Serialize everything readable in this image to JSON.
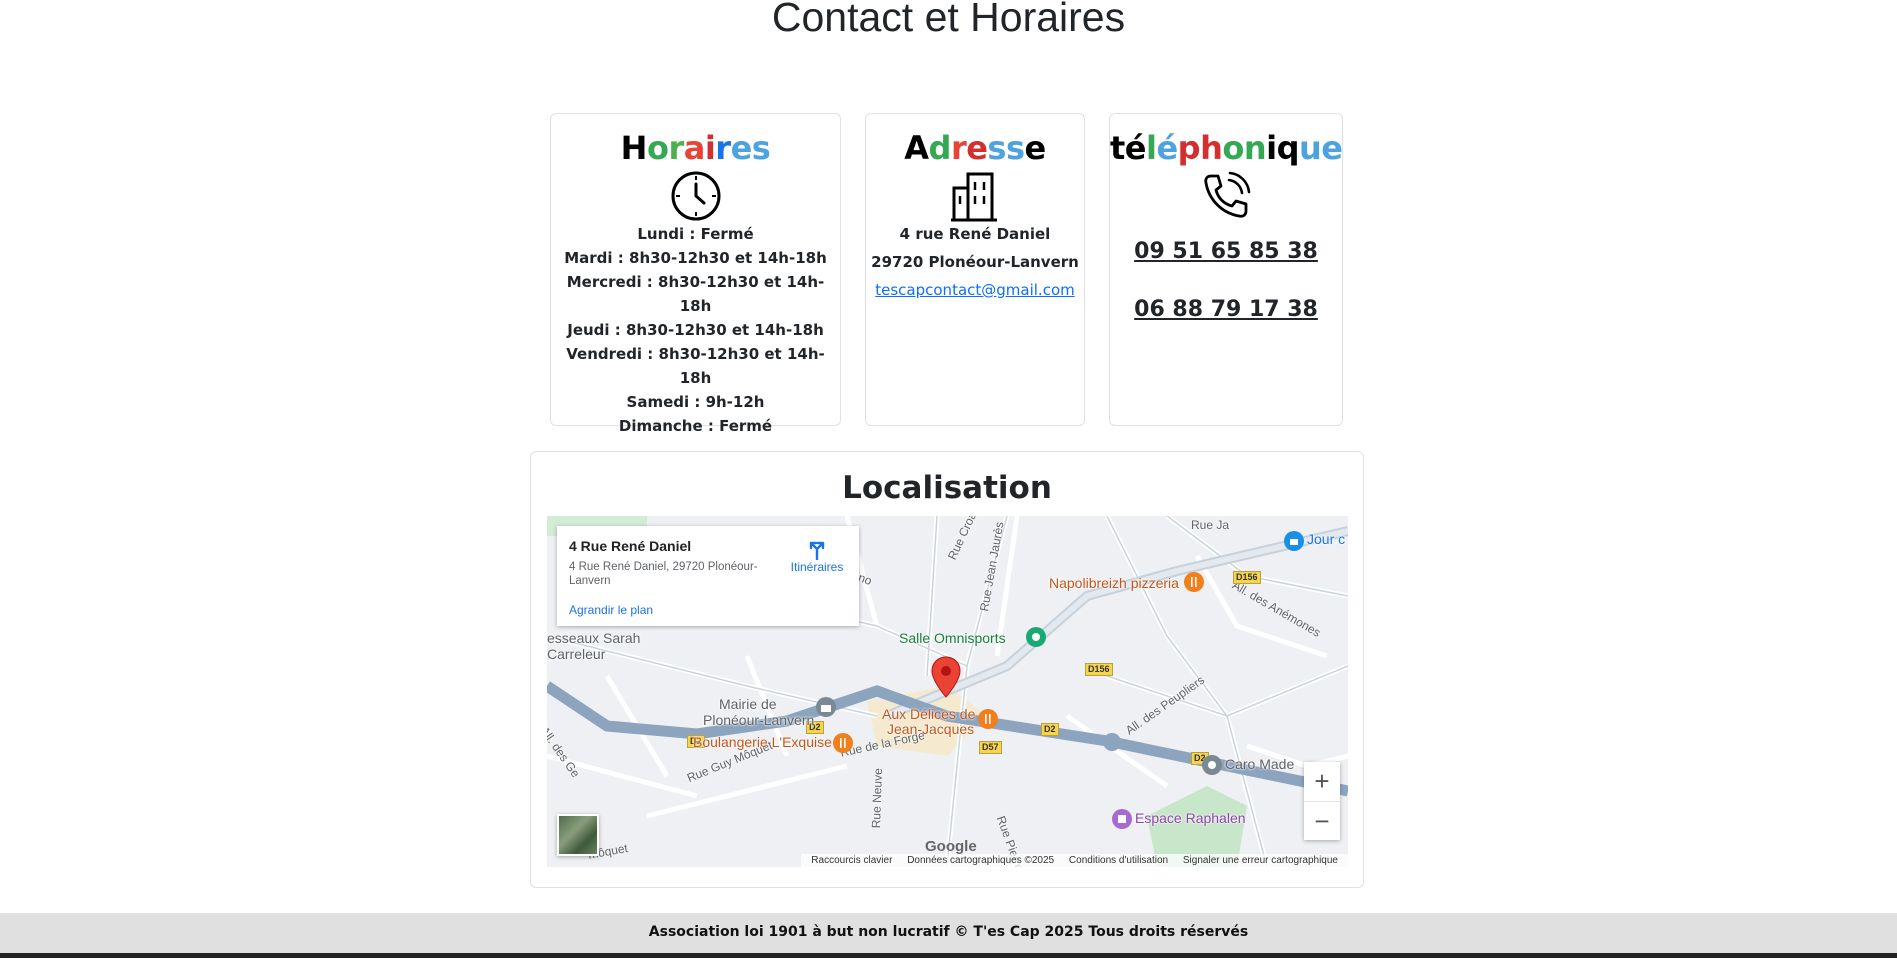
{
  "page_title": "Contact et Horaires",
  "hours": {
    "title_letters": [
      {
        "ch": "H",
        "color": "#000000"
      },
      {
        "ch": "o",
        "color": "#34a853"
      },
      {
        "ch": "r",
        "color": "#4caf50"
      },
      {
        "ch": "a",
        "color": "#ea4335"
      },
      {
        "ch": "i",
        "color": "#d32f2f"
      },
      {
        "ch": "r",
        "color": "#1a73e8"
      },
      {
        "ch": "e",
        "color": "#4da3e0"
      },
      {
        "ch": "s",
        "color": "#4da3e0"
      }
    ],
    "icon": "clock-icon",
    "lines": [
      "Lundi : Fermé",
      "Mardi : 8h30-12h30 et 14h-18h",
      "Mercredi : 8h30-12h30 et 14h-18h",
      "Jeudi : 8h30-12h30 et 14h-18h",
      "Vendredi : 8h30-12h30 et 14h-18h",
      "Samedi : 9h-12h",
      "Dimanche : Fermé"
    ]
  },
  "address": {
    "title_letters": [
      {
        "ch": "A",
        "color": "#000000"
      },
      {
        "ch": "d",
        "color": "#34a853"
      },
      {
        "ch": "r",
        "color": "#ea4335"
      },
      {
        "ch": "e",
        "color": "#d32f2f"
      },
      {
        "ch": "s",
        "color": "#4da3e0"
      },
      {
        "ch": "s",
        "color": "#4da3e0"
      },
      {
        "ch": "e",
        "color": "#000000"
      }
    ],
    "icon": "building-icon",
    "street": "4 rue René Daniel",
    "city": "29720 Plonéour-Lanvern",
    "email": "tescapcontact@gmail.com"
  },
  "phone": {
    "title_letters": [
      {
        "ch": "t",
        "color": "#000000"
      },
      {
        "ch": "é",
        "color": "#000000"
      },
      {
        "ch": "l",
        "color": "#34a853"
      },
      {
        "ch": "é",
        "color": "#4da3e0"
      },
      {
        "ch": "p",
        "color": "#d32f2f"
      },
      {
        "ch": "h",
        "color": "#d32f2f"
      },
      {
        "ch": "o",
        "color": "#34a853"
      },
      {
        "ch": "n",
        "color": "#34a853"
      },
      {
        "ch": "i",
        "color": "#000000"
      },
      {
        "ch": "q",
        "color": "#000000"
      },
      {
        "ch": "u",
        "color": "#4da3e0"
      },
      {
        "ch": "e",
        "color": "#4da3e0"
      }
    ],
    "icon": "phone-icon",
    "numbers": [
      "09 51 65 85 38",
      "06 88 79 17 38"
    ]
  },
  "map_section": {
    "title": "Localisation",
    "infobox": {
      "title": "4 Rue René Daniel",
      "address": "4 Rue René Daniel, 29720 Plonéour-Lanvern",
      "directions_label": "Itinéraires",
      "enlarge_label": "Agrandir le plan"
    },
    "pois": {
      "pizzeria": "Napolibreizh pizzeria",
      "jour": "Jour c",
      "omnisports": "Salle Omnisports",
      "mairie_1": "Mairie de",
      "mairie_2": "Plonéour-Lanvern",
      "delices_1": "Aux Délices de",
      "delices_2": "Jean-Jacques",
      "boulangerie": "Boulangerie L'Exquise",
      "carreleur_1": "esseaux Sarah",
      "carreleur_2": "Carreleur",
      "caro": "Caro Made",
      "espace": "Espace Raphalen"
    },
    "roads": {
      "r1": "Rue Croas ar Bli",
      "r2": "Rue Jean Jaurès",
      "r3": "All. des Anémones",
      "r4": "All. des Peupliers",
      "r5": "Rue de la Forge",
      "r6": "Rue Guy Môquet",
      "r7": "Rue Neuve",
      "r8": "Rue Pierre",
      "r9": "Rue Ja",
      "r10": "ano",
      "r11": "ua",
      "r12": "Guy Mô",
      "r13": "All. des Ge",
      "r14": "môquet"
    },
    "shields": {
      "d156a": "D156",
      "d156b": "D156",
      "d2a": "D2",
      "d2b": "D2",
      "d2c": "D2",
      "d2d": "D2",
      "d57": "D57"
    },
    "zoom_in": "+",
    "zoom_out": "−",
    "attribution": [
      "Raccourcis clavier",
      "Données cartographiques ©2025",
      "Conditions d'utilisation",
      "Signaler une erreur cartographique"
    ],
    "google_logo": "Google"
  },
  "footer": "Association loi 1901 à but non lucratif © T'es Cap 2025 Tous droits réservés",
  "colors": {
    "link": "#0d6efd",
    "pin": "#ea4335",
    "footer_bg": "#e0e0e0"
  }
}
